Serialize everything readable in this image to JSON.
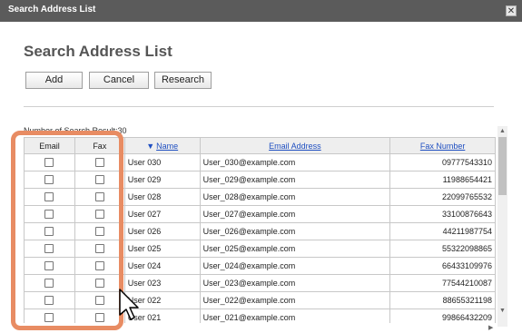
{
  "window": {
    "title": "Search Address List",
    "close_icon": "close-icon"
  },
  "dialog": {
    "heading": "Search Address List"
  },
  "toolbar": {
    "add_label": "Add",
    "cancel_label": "Cancel",
    "research_label": "Research"
  },
  "results": {
    "count_text": "Number of Search Result:30"
  },
  "table": {
    "headers": {
      "email": "Email",
      "fax": "Fax",
      "name": "Name",
      "email_address": "Email Address",
      "fax_number": "Fax Number"
    },
    "sort_indicator": "▼",
    "rows": [
      {
        "name": "User 030",
        "email": "User_030@example.com",
        "fax": "09777543310"
      },
      {
        "name": "User 029",
        "email": "User_029@example.com",
        "fax": "11988654421"
      },
      {
        "name": "User 028",
        "email": "User_028@example.com",
        "fax": "22099765532"
      },
      {
        "name": "User 027",
        "email": "User_027@example.com",
        "fax": "33100876643"
      },
      {
        "name": "User 026",
        "email": "User_026@example.com",
        "fax": "44211987754"
      },
      {
        "name": "User 025",
        "email": "User_025@example.com",
        "fax": "55322098865"
      },
      {
        "name": "User 024",
        "email": "User_024@example.com",
        "fax": "66433109976"
      },
      {
        "name": "User 023",
        "email": "User_023@example.com",
        "fax": "77544210087"
      },
      {
        "name": "User 022",
        "email": "User_022@example.com",
        "fax": "88655321198"
      },
      {
        "name": "User 021",
        "email": "User_021@example.com",
        "fax": "99866432209"
      }
    ]
  },
  "colors": {
    "titlebar": "#5b5b5b",
    "highlight": "#e88c63",
    "link": "#1f4fc1"
  }
}
